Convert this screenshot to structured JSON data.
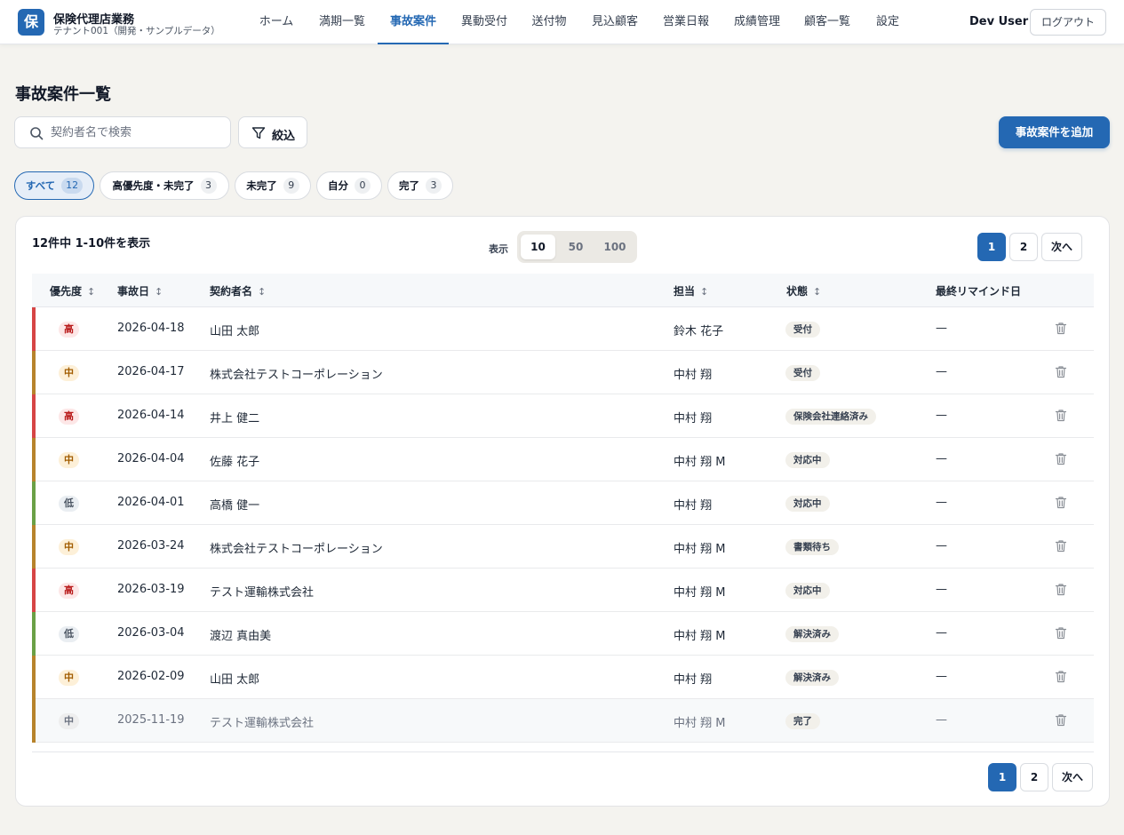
{
  "header": {
    "logo_char": "保",
    "app_title": "保険代理店業務",
    "tenant": "テナント001（開発・サンプルデータ）",
    "nav": [
      {
        "label": "ホーム"
      },
      {
        "label": "満期一覧"
      },
      {
        "label": "事故案件",
        "active": true
      },
      {
        "label": "異動受付"
      },
      {
        "label": "送付物"
      },
      {
        "label": "見込顧客"
      },
      {
        "label": "営業日報"
      },
      {
        "label": "成績管理"
      },
      {
        "label": "顧客一覧"
      },
      {
        "label": "設定"
      }
    ],
    "user_name": "Dev User",
    "logout_label": "ログアウト"
  },
  "page": {
    "title": "事故案件一覧",
    "search_placeholder": "契約者名で検索",
    "filter_label": "絞込",
    "add_label": "事故案件を追加"
  },
  "chips": [
    {
      "label": "すべて",
      "count": "12",
      "active": true
    },
    {
      "label": "高優先度・未完了",
      "count": "3"
    },
    {
      "label": "未完了",
      "count": "9"
    },
    {
      "label": "自分",
      "count": "0"
    },
    {
      "label": "完了",
      "count": "3"
    }
  ],
  "list": {
    "summary": "12件中 1-10件を表示",
    "display_label": "表示",
    "page_sizes": [
      "10",
      "50",
      "100"
    ],
    "selected_page_size": "10",
    "pages": [
      "1",
      "2"
    ],
    "current_page": "1",
    "next_label": "次へ",
    "columns": [
      "優先度",
      "事故日",
      "契約者名",
      "担当",
      "状態",
      "最終リマインド日"
    ],
    "sort_glyph": "↕",
    "rows": [
      {
        "priority": "高",
        "level": "high",
        "date": "2026-04-18",
        "name": "山田 太郎",
        "owner": "鈴木 花子",
        "status": "受付",
        "reminder": "—"
      },
      {
        "priority": "中",
        "level": "mid",
        "date": "2026-04-17",
        "name": "株式会社テストコーポレーション",
        "owner": "中村 翔",
        "status": "受付",
        "reminder": "—"
      },
      {
        "priority": "高",
        "level": "high",
        "date": "2026-04-14",
        "name": "井上 健二",
        "owner": "中村 翔",
        "status": "保険会社連絡済み",
        "reminder": "—"
      },
      {
        "priority": "中",
        "level": "mid",
        "date": "2026-04-04",
        "name": "佐藤 花子",
        "owner": "中村 翔 M",
        "status": "対応中",
        "reminder": "—"
      },
      {
        "priority": "低",
        "level": "low",
        "date": "2026-04-01",
        "name": "高橋 健一",
        "owner": "中村 翔",
        "status": "対応中",
        "reminder": "—"
      },
      {
        "priority": "中",
        "level": "mid",
        "date": "2026-03-24",
        "name": "株式会社テストコーポレーション",
        "owner": "中村 翔 M",
        "status": "書類待ち",
        "reminder": "—"
      },
      {
        "priority": "高",
        "level": "high",
        "date": "2026-03-19",
        "name": "テスト運輸株式会社",
        "owner": "中村 翔 M",
        "status": "対応中",
        "reminder": "—"
      },
      {
        "priority": "低",
        "level": "low",
        "date": "2026-03-04",
        "name": "渡辺 真由美",
        "owner": "中村 翔 M",
        "status": "解決済み",
        "reminder": "—"
      },
      {
        "priority": "中",
        "level": "mid",
        "date": "2026-02-09",
        "name": "山田 太郎",
        "owner": "中村 翔",
        "status": "解決済み",
        "reminder": "—"
      },
      {
        "priority": "中",
        "level": "mid",
        "date": "2025-11-19",
        "name": "テスト運輸株式会社",
        "owner": "中村 翔 M",
        "status": "完了",
        "reminder": "—",
        "done": true
      }
    ]
  },
  "colors": {
    "accent": "#2468b3",
    "priority_high_bar": "#d64545",
    "priority_mid_bar": "#b7832b",
    "priority_low_bar": "#6aa046"
  }
}
